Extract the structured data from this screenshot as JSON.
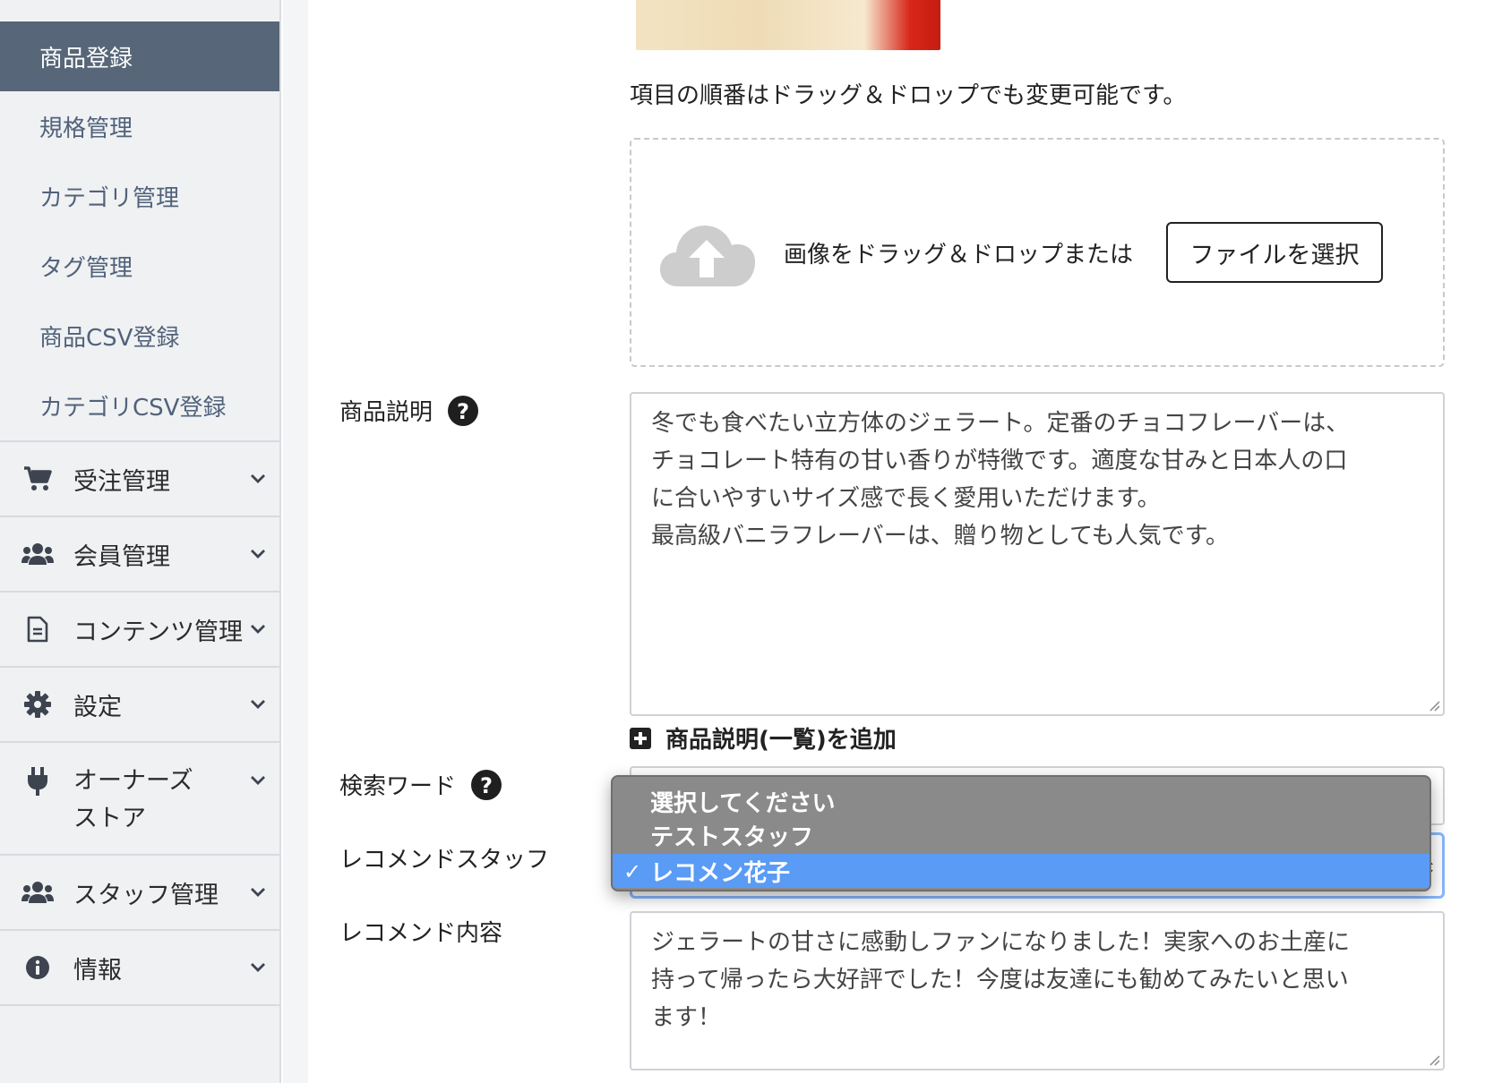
{
  "sidebar": {
    "sub_items": [
      {
        "label": "商品登録",
        "active": true
      },
      {
        "label": "規格管理"
      },
      {
        "label": "カテゴリ管理"
      },
      {
        "label": "タグ管理"
      },
      {
        "label": "商品CSV登録"
      },
      {
        "label": "カテゴリCSV登録"
      }
    ],
    "menus": [
      {
        "label": "受注管理",
        "icon": "cart-icon"
      },
      {
        "label": "会員管理",
        "icon": "users-icon"
      },
      {
        "label": "コンテンツ管理",
        "icon": "document-icon"
      },
      {
        "label": "設定",
        "icon": "gear-icon"
      },
      {
        "label": "オーナーズストア",
        "icon": "plug-icon"
      },
      {
        "label": "スタッフ管理",
        "icon": "users-icon"
      },
      {
        "label": "情報",
        "icon": "info-icon"
      }
    ]
  },
  "form": {
    "order_note": "項目の順番はドラッグ＆ドロップでも変更可能です。",
    "dropzone_text": "画像をドラッグ＆ドロップまたは",
    "file_button": "ファイルを選択",
    "description_label": "商品説明",
    "description_value": "冬でも食べたい立方体のジェラート。定番のチョコフレーバーは、\nチョコレート特有の甘い香りが特徴です。適度な甘みと日本人の口\nに合いやすいサイズ感で長く愛用いただけます。\n最高級バニラフレーバーは、贈り物としても人気です。",
    "add_list_description": "商品説明(一覧)を追加",
    "search_word_label": "検索ワード",
    "recommend_staff_label": "レコメンドスタッフ",
    "recommend_content_label": "レコメンド内容",
    "recommend_content_value": "ジェラートの甘さに感動しファンになりました！実家へのお土産に\n持って帰ったら大好評でした！今度は友達にも勧めてみたいと思い\nます！"
  },
  "dropdown": {
    "options": [
      "選択してください",
      "テストスタッフ",
      "レコメン花子"
    ],
    "selected": "レコメン花子",
    "check": "✓"
  },
  "colors": {
    "sidebar_active_bg": "#576678",
    "sidebar_bg": "#eff1f3",
    "dropdown_bg": "#8a8a8a",
    "dropdown_selected": "#5a9bf5",
    "focus_border": "#86b7fe"
  }
}
